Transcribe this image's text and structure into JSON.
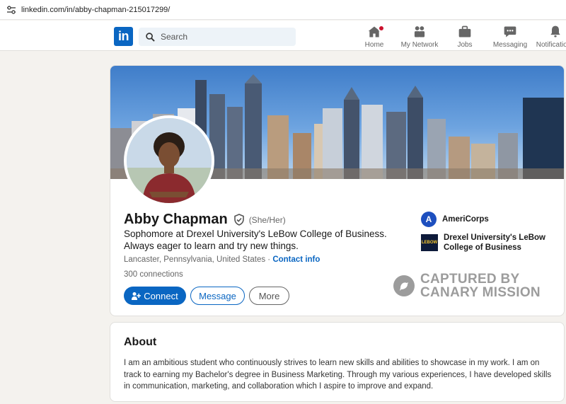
{
  "browser": {
    "url": "linkedin.com/in/abby-chapman-215017299/"
  },
  "nav": {
    "logo": "in",
    "search_placeholder": "Search",
    "items": [
      {
        "label": "Home",
        "icon": "home-icon",
        "badge": true
      },
      {
        "label": "My Network",
        "icon": "network-icon"
      },
      {
        "label": "Jobs",
        "icon": "briefcase-icon"
      },
      {
        "label": "Messaging",
        "icon": "message-icon"
      },
      {
        "label": "Notifications",
        "icon": "bell-icon"
      }
    ]
  },
  "profile": {
    "name": "Abby Chapman",
    "pronouns": "(She/Her)",
    "headline": "Sophomore at Drexel University's LeBow College of Business. Always eager to learn and try new things.",
    "location": "Lancaster, Pennsylvania, United States",
    "location_separator": " · ",
    "contact_info": "Contact info",
    "connections": "300 connections",
    "buttons": {
      "connect": "Connect",
      "message": "Message",
      "more": "More"
    },
    "organizations": [
      {
        "name": "AmeriCorps",
        "logo_text": "A"
      },
      {
        "name": "Drexel University's LeBow College of Business",
        "line1": "Drexel University's LeBow",
        "line2": "College of Business",
        "logo_text": "LEBOW"
      }
    ],
    "watermark": {
      "line1": "CAPTURED BY",
      "line2": "CANARY MISSION"
    }
  },
  "about": {
    "title": "About",
    "text": "I am an ambitious student who continuously strives to learn new skills and abilities to showcase in my work. I am on track to earning my Bachelor's degree in Business Marketing. Through my various experiences, I have developed skills in communication, marketing, and collaboration which I aspire to improve and expand."
  },
  "colors": {
    "brand": "#0a66c2",
    "badge": "#cb112d",
    "background": "#f4f2ee"
  }
}
